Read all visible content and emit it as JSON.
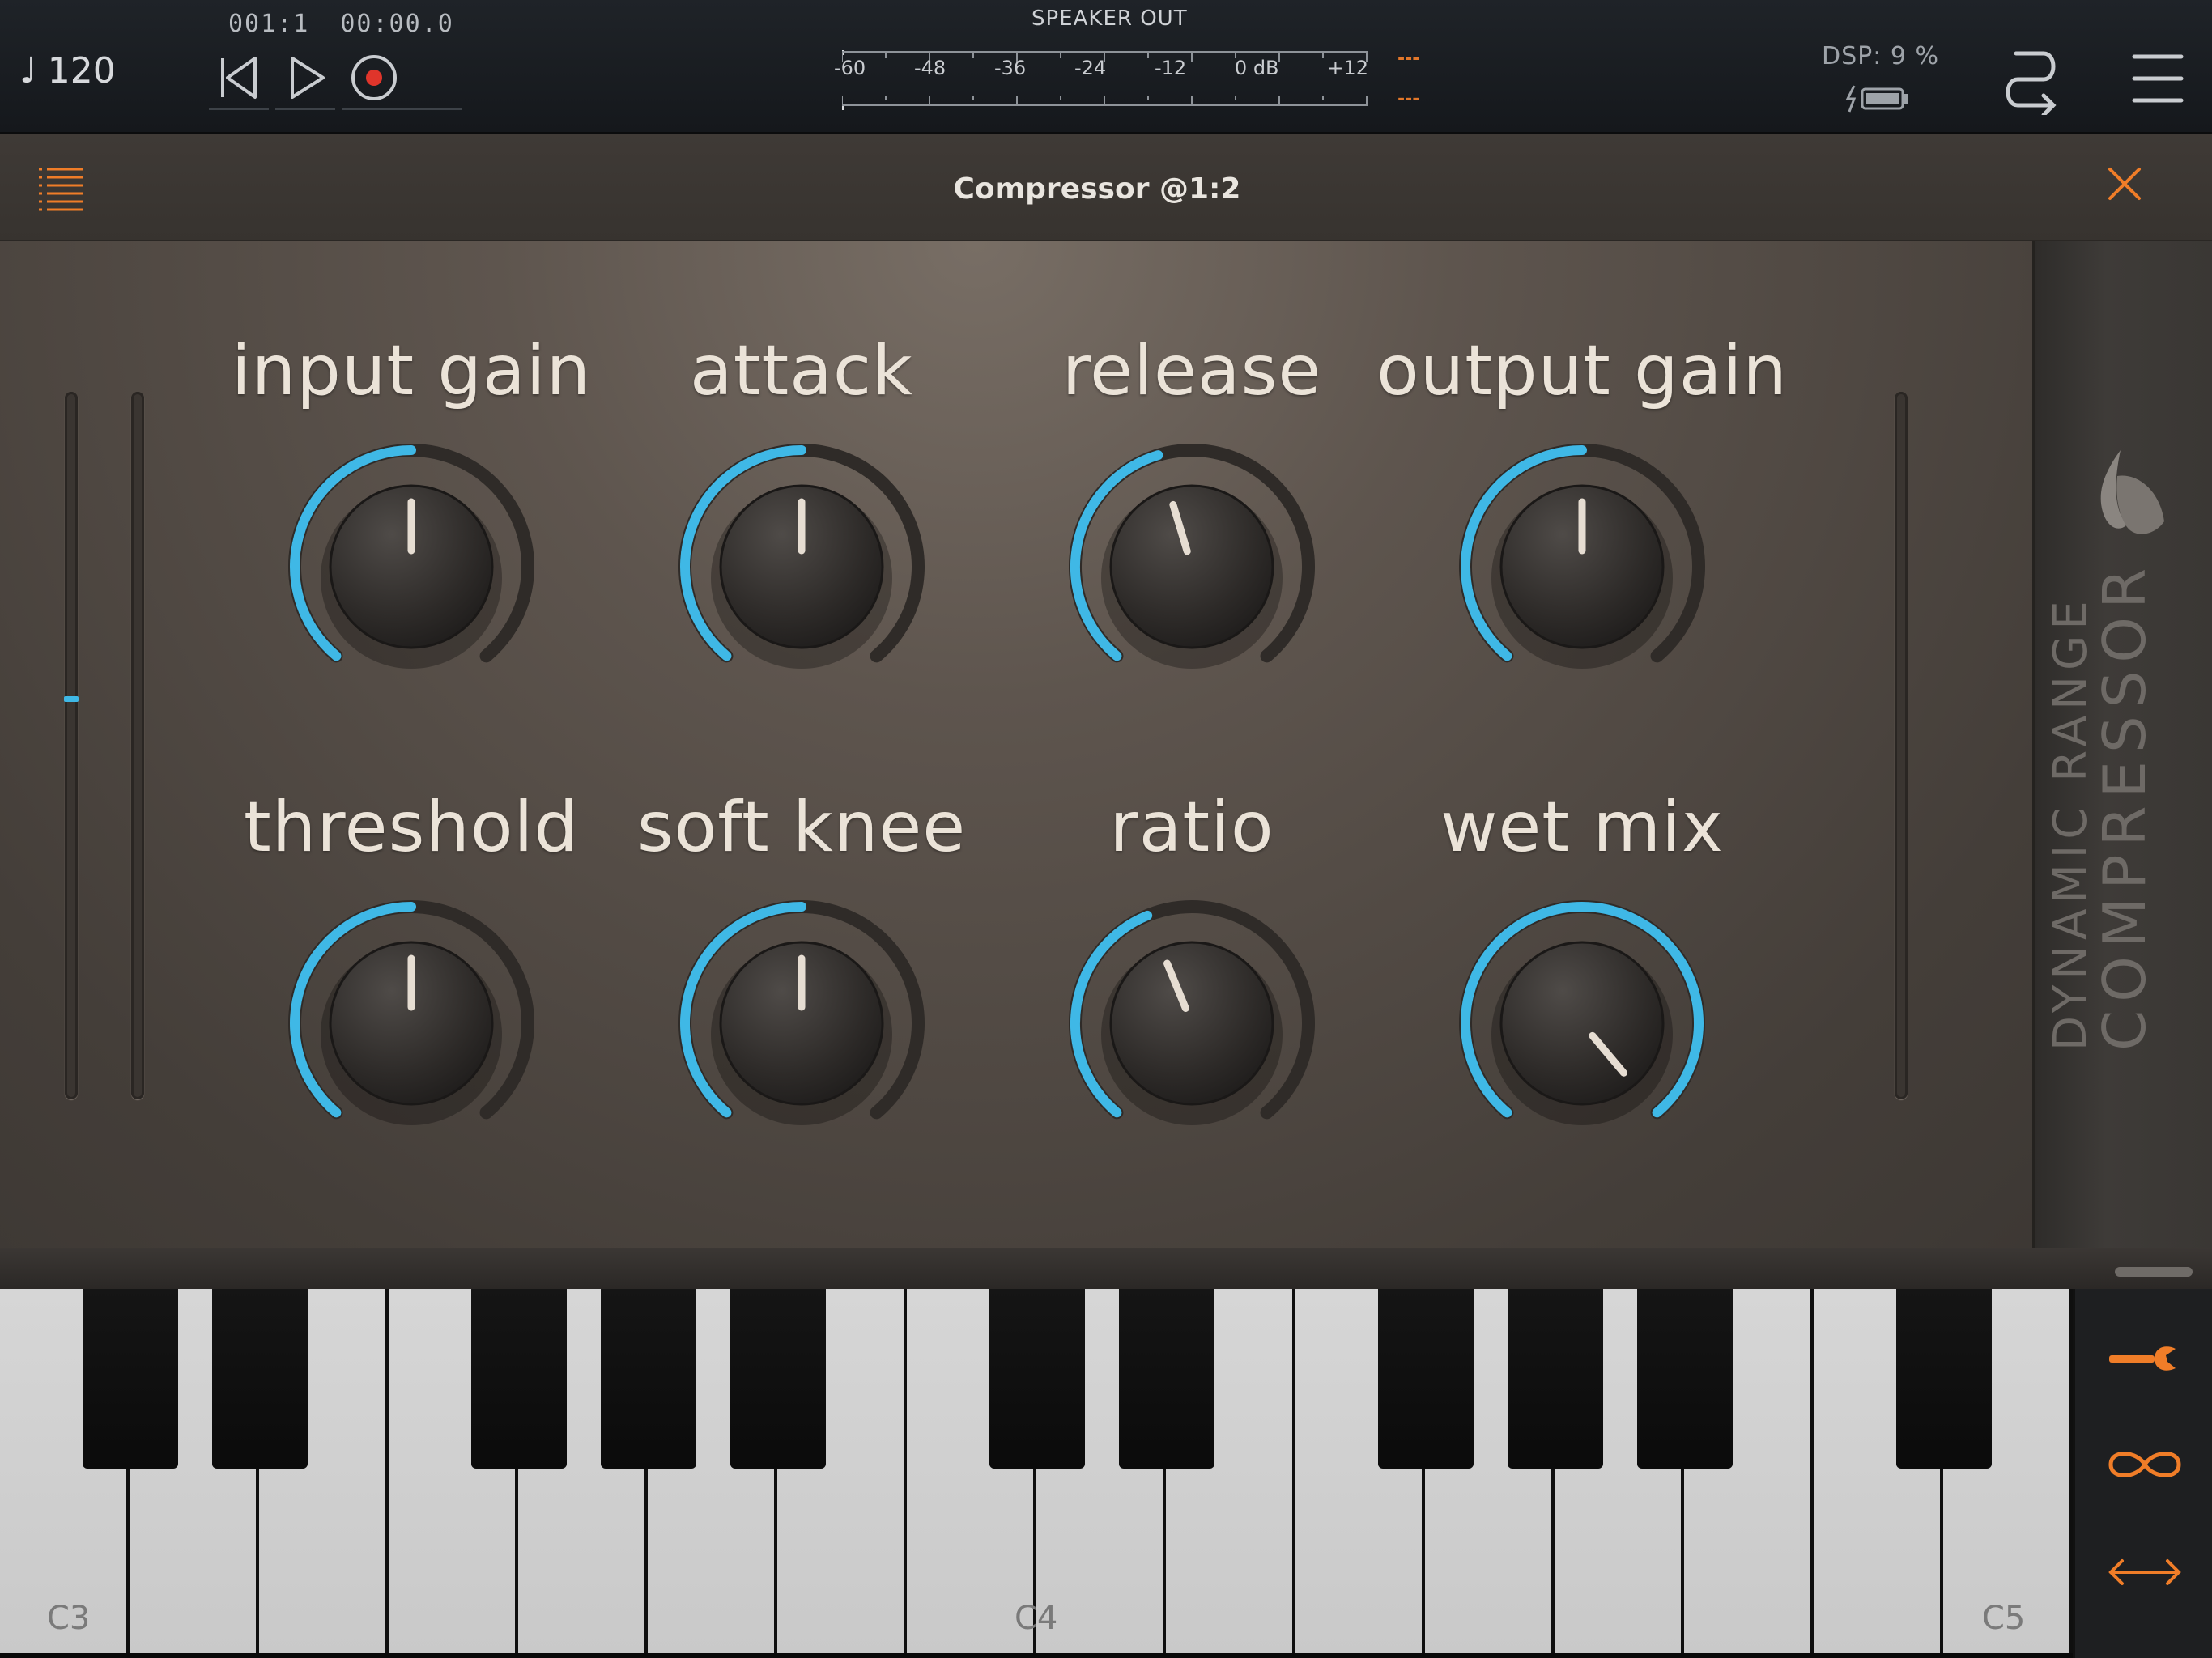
{
  "transport": {
    "tempo": "♩ 120",
    "bar_position": "001:1",
    "time_position": "00:00.0"
  },
  "meter": {
    "label": "SPEAKER OUT",
    "scale": [
      "-60",
      "-48",
      "-36",
      "-24",
      "-12",
      "0 dB",
      "+12"
    ],
    "peak_left": "---",
    "peak_right": "---"
  },
  "status": {
    "dsp": "DSP:  9 %"
  },
  "plugin": {
    "title": "Compressor @1:2",
    "brand_line_1": "DYNAMIC RANGE",
    "brand_line_2": "COMPRESSOR"
  },
  "knobs": [
    {
      "label": "input gain",
      "value": 0.5
    },
    {
      "label": "attack",
      "value": 0.5
    },
    {
      "label": "release",
      "value": 0.44
    },
    {
      "label": "output gain",
      "value": 0.5
    },
    {
      "label": "threshold",
      "value": 0.5
    },
    {
      "label": "soft knee",
      "value": 0.5
    },
    {
      "label": "ratio",
      "value": 0.42
    },
    {
      "label": "wet mix",
      "value": 1.0
    }
  ],
  "sliders": {
    "input_level": 0.57
  },
  "keyboard": {
    "labels": [
      "C3",
      "C4",
      "C5"
    ]
  },
  "colors": {
    "accent": "#3fb8e6",
    "tool_accent": "#f07d28"
  }
}
